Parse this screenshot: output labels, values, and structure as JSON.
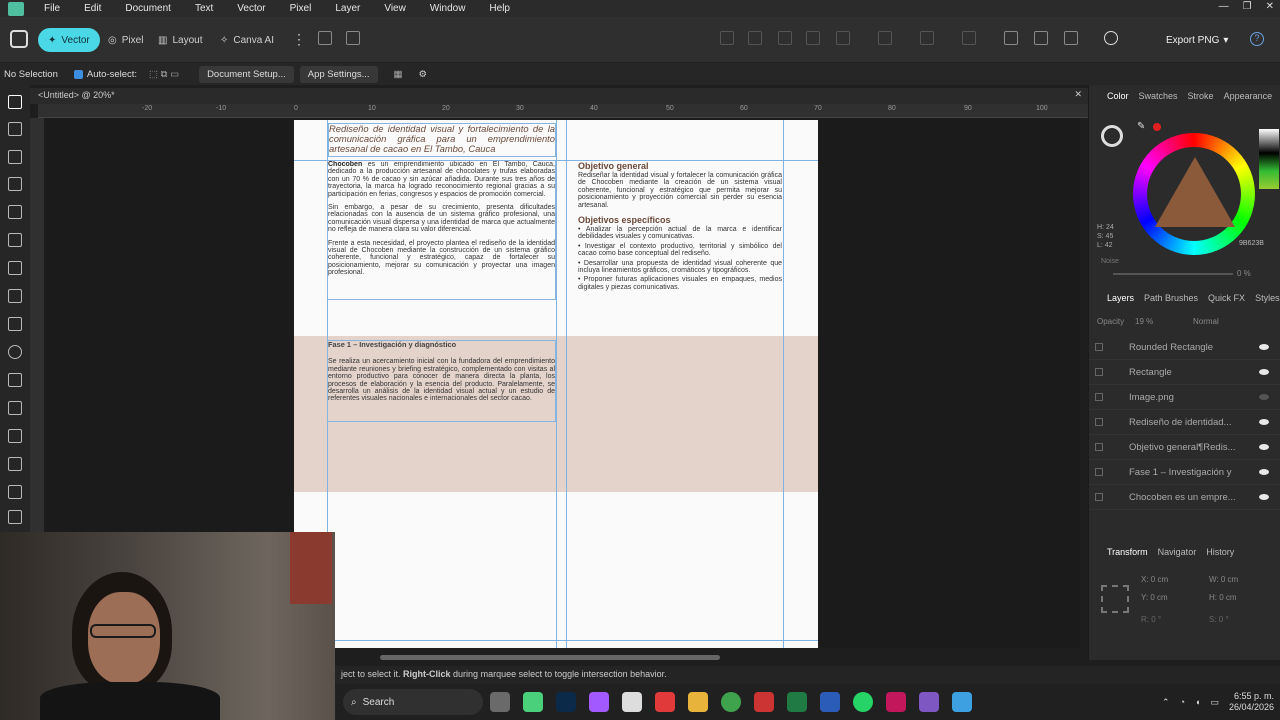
{
  "menu": [
    "File",
    "Edit",
    "Document",
    "Text",
    "Vector",
    "Pixel",
    "Layer",
    "View",
    "Window",
    "Help"
  ],
  "personas": {
    "vector": "Vector",
    "pixel": "Pixel",
    "layout": "Layout",
    "canva": "Canva AI"
  },
  "export_label": "Export PNG",
  "ctx": {
    "selection": "No Selection",
    "autoselect": "Auto-select:",
    "doc_setup": "Document Setup...",
    "app_settings": "App Settings..."
  },
  "doc_tab": "<Untitled> @ 20%*",
  "ruler_marks": [
    "-20",
    "-10",
    "0",
    "10",
    "20",
    "30",
    "40",
    "50",
    "60",
    "70",
    "80",
    "90",
    "100"
  ],
  "document": {
    "title": "Rediseño de identidad visual y fortalecimiento de la comunicación gráfica para un emprendimiento artesanal de cacao en El Tambo, Cauca",
    "col1": {
      "p1_bold": "Chocoben",
      "p1": " es un emprendimiento ubicado en El Tambo, Cauca, dedicado a la producción artesanal de chocolates y trufas elaboradas con un 70 % de cacao y sin azúcar añadida. Durante sus tres años de trayectoria, la marca ha logrado reconocimiento regional gracias a su participación en ferias, congresos y espacios de promoción comercial.",
      "p2": "Sin embargo, a pesar de su crecimiento, presenta dificultades relacionadas con la ausencia de un sistema gráfico profesional, una comunicación visual dispersa y una identidad de marca que actualmente no refleja de manera clara su valor diferencial.",
      "p3": "Frente a esta necesidad, el proyecto plantea el rediseño de la identidad visual de Chocoben mediante la construcción de un sistema gráfico coherente, funcional y estratégico, capaz de fortalecer su posicionamiento, mejorar su comunicación y proyectar una imagen profesional."
    },
    "col2": {
      "h_general": "Objetivo general",
      "general": "Rediseñar la identidad visual y fortalecer la comunicación gráfica de Chocoben mediante la creación de un sistema visual coherente, funcional y estratégico que permita mejorar su posicionamiento y proyección comercial sin perder su esencia artesanal.",
      "h_especificos": "Objetivos específicos",
      "e1": "• Analizar la percepción actual de la marca e identificar debilidades visuales y comunicativas.",
      "e2": "• Investigar el contexto productivo, territorial y simbólico del cacao como base conceptual del rediseño.",
      "e3": "• Desarrollar una propuesta de identidad visual coherente que incluya lineamientos gráficos, cromáticos y tipográficos.",
      "e4": "• Proponer futuras aplicaciones visuales en empaques, medios digitales y piezas comunicativas."
    },
    "fase": {
      "h": "Fase 1 – Investigación y diagnóstico",
      "p": "Se realiza un acercamiento inicial con la fundadora del emprendimiento mediante reuniones y briefing estratégico, complementado con visitas al entorno productivo para conocer de manera directa la planta, los procesos de elaboración y la esencia del producto. Paralelamente, se desarrolla un análisis de la identidad visual actual y un estudio de referentes visuales nacionales e internacionales del sector cacao."
    }
  },
  "panel": {
    "tabs": [
      "Color",
      "Swatches",
      "Stroke",
      "Appearance"
    ],
    "hsl": [
      "H: 24",
      "S: 45",
      "L: 42"
    ],
    "hex": "9B623B",
    "noise": "Noise",
    "noise_val": "0 %",
    "layer_tabs": [
      "Layers",
      "Path Brushes",
      "Quick FX",
      "Styles"
    ],
    "opacity_label": "Opacity",
    "opacity": "19 %",
    "blend": "Normal",
    "layers": [
      "Rounded Rectangle",
      "Rectangle",
      "Image.png",
      "Rediseño de identidad...",
      "Objetivo general¶Redis...",
      "Fase 1 – Investigación y",
      "Chocoben es un empre..."
    ],
    "tr_tabs": [
      "Transform",
      "Navigator",
      "History"
    ],
    "tr": {
      "x": "X:",
      "y": "Y:",
      "w": "W:",
      "h": "H:",
      "r": "R:",
      "s": "S:",
      "x_val": "0 cm",
      "y_val": "0 cm",
      "w_val": "0 cm",
      "h_val": "0 cm",
      "r_val": "0 °",
      "s_val": "0 °"
    }
  },
  "status": {
    "text": "ject to select it. ",
    "bold": "Right-Click",
    "rest": " during marquee select to toggle intersection behavior."
  },
  "taskbar": {
    "search": "Search",
    "time": "6:55 p. m.",
    "date": "26/04/2026"
  },
  "colors": {
    "accent": "#4ad7e6",
    "band": "#e3d3ca",
    "title_brown": "#6b4a3a",
    "guide": "#7fb3e3"
  }
}
